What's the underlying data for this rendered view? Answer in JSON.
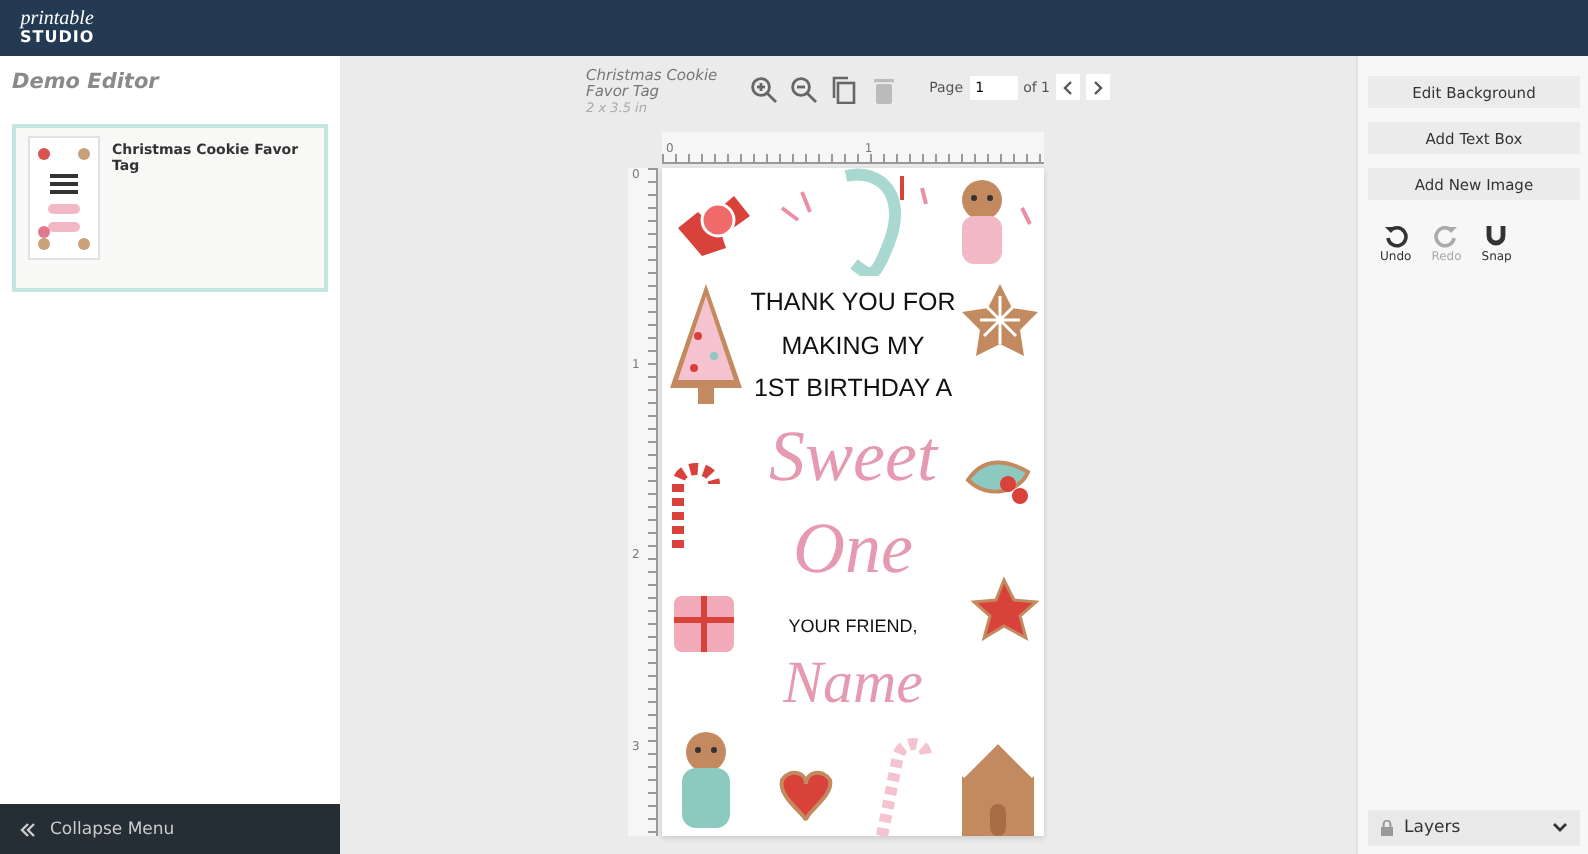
{
  "app": {
    "logo_script": "printable",
    "logo_word": "STUDIO"
  },
  "sidebar": {
    "title": "Demo Editor",
    "projects": [
      {
        "name": "Christmas Cookie Favor Tag",
        "selected": true
      }
    ],
    "collapse_label": "Collapse Menu"
  },
  "document": {
    "title": "Christmas Cookie Favor Tag",
    "size": "2 x 3.5 in"
  },
  "tools": [
    {
      "kind": "zoom-in",
      "disabled": false
    },
    {
      "kind": "zoom-out",
      "disabled": false
    },
    {
      "kind": "copy",
      "disabled": false
    },
    {
      "kind": "delete",
      "disabled": true
    }
  ],
  "pager": {
    "label": "Page",
    "value": "1",
    "total": "of 1"
  },
  "ruler": {
    "x_labels": [
      "0",
      "1"
    ],
    "y_labels": [
      "0",
      "1",
      "2",
      "3"
    ]
  },
  "card": {
    "lines": [
      {
        "kind": "print",
        "text": "THANK YOU FOR"
      },
      {
        "kind": "print",
        "text": "MAKING MY"
      },
      {
        "kind": "print",
        "text": "1ST BIRTHDAY A"
      },
      {
        "kind": "script",
        "text": "Sweet"
      },
      {
        "kind": "script",
        "text": "One"
      },
      {
        "kind": "small",
        "text": "YOUR FRIEND,"
      },
      {
        "kind": "name",
        "text": "Name"
      }
    ]
  },
  "actions": [
    "Edit Background",
    "Add Text Box",
    "Add New Image"
  ],
  "history": [
    {
      "kind": "undo",
      "label": "Undo",
      "disabled": false
    },
    {
      "kind": "redo",
      "label": "Redo",
      "disabled": true
    },
    {
      "kind": "snap",
      "label": "Snap",
      "disabled": false
    }
  ],
  "layers": {
    "label": "Layers",
    "expanded": false
  }
}
